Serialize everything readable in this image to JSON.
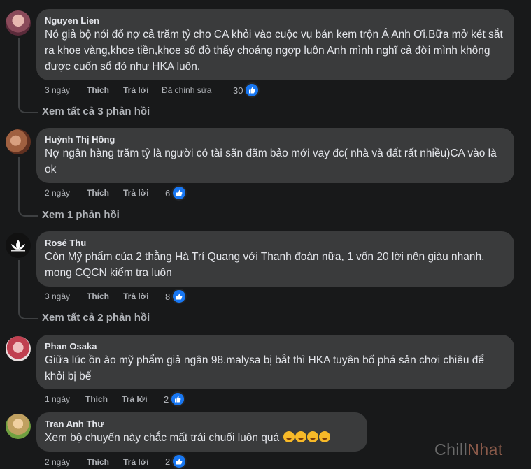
{
  "comments": [
    {
      "author": "Nguyen Lien",
      "text": "Nó giả bộ nói đổ nợ cả trăm tỷ cho CA khỏi vào cuộc vụ bán kem trộn Á Anh Ơi.Bữa mở két sắt ra khoe vàng,khoe tiền,khoe sổ đỏ thấy choáng ngợp luôn Anh mình nghĩ cả đời mình không được cuốn sổ đỏ như HKA luôn.",
      "time": "3 ngày",
      "like": "Thích",
      "reply": "Trả lời",
      "edited": "Đã chỉnh sửa",
      "reactions": "30",
      "view_replies": "Xem tất cả 3 phản hồi"
    },
    {
      "author": "Huỳnh Thị Hồng",
      "text": "Nợ ngân hàng trăm tỷ là người có tài sãn đãm bảo mới vay đc( nhà và đất rất nhiều)CA vào là ok",
      "time": "2 ngày",
      "like": "Thích",
      "reply": "Trả lời",
      "reactions": "6",
      "view_replies": "Xem 1 phản hồi"
    },
    {
      "author": "Rosé Thu",
      "text": "Còn Mỹ phẩm của 2 thằng Hà Trí Quang với Thanh đoàn nữa, 1 vốn 20 lời nên giàu nhanh, mong CQCN kiểm tra luôn",
      "time": "3 ngày",
      "like": "Thích",
      "reply": "Trả lời",
      "reactions": "8",
      "view_replies": "Xem tất cả 2 phản hồi"
    },
    {
      "author": "Phan Osaka",
      "text": "Giữa lúc ồn ào mỹ phẩm giả ngân 98.malysa bị bắt thì HKA tuyên bố phá sản chơi chiêu để khỏi bị bế",
      "time": "1 ngày",
      "like": "Thích",
      "reply": "Trả lời",
      "reactions": "2"
    },
    {
      "author": "Tran Anh Thư",
      "text": "Xem bộ chuyến này chắc mất trái chuối luôn quá",
      "time": "2 ngày",
      "like": "Thích",
      "reply": "Trả lời",
      "reactions": "2"
    }
  ],
  "watermark": {
    "part1": "Chill",
    "part2": "Nhat"
  },
  "colors": {
    "background": "#18191a",
    "bubble": "#3a3b3c",
    "like_blue": "#1877f2"
  }
}
